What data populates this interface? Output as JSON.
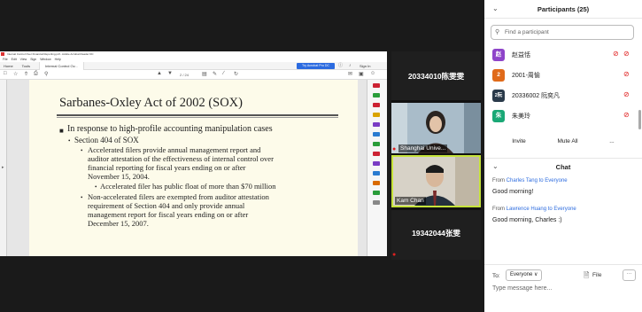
{
  "pdf": {
    "window_title": "Internal Control Over Financial Reporting.pdf - Adobe Acrobat Reader DC",
    "menu": [
      "File",
      "Edit",
      "View",
      "Sign",
      "Window",
      "Help"
    ],
    "tab_home": "Home",
    "tab_tools": "Tools",
    "doc_tab": "Internal Control Ov...",
    "try_pro": "Try Acrobat Pro DC",
    "sign_in": "Sign In",
    "page_indicator": "2 / 24"
  },
  "slide": {
    "title": "Sarbanes-Oxley Act of 2002 (SOX)",
    "l1": "In response to high-profile accounting manipulation cases",
    "l2": "Section 404 of SOX",
    "l3a_1": "Accelerated filers provide annual management report and",
    "l3a_2": "auditor attestation of the effectiveness of internal control over",
    "l3a_3": "financial reporting for fiscal years ending on or after",
    "l3a_4": "November 15, 2004.",
    "l4": "Accelerated filer has public float of more than $70 million",
    "l3b_1": "Non-accelerated filers are exempted from auditor attestation",
    "l3b_2": "requirement of Section 404 and only provide annual",
    "l3b_3": "management report for fiscal years ending on or after",
    "l3b_4": "December 15, 2007."
  },
  "video": {
    "tile1_name": "20334010陈雯雯",
    "tile2_label": "Shanghai Unive...",
    "tile3_label": "Kam Chan",
    "tile4_name": "19342044张雯"
  },
  "participants": {
    "title": "Participants (25)",
    "search_placeholder": "Find a participant",
    "rows": [
      {
        "avatar": "赵",
        "name": "赵益恬",
        "color": "#8e44c9"
      },
      {
        "avatar": "2",
        "name": "2001-周愉",
        "color": "#e06a1a"
      },
      {
        "avatar": "2阮",
        "name": "20336002 阮奕凡",
        "color": "#2a3a4a"
      },
      {
        "avatar": "朱",
        "name": "朱美玲",
        "color": "#1aa876"
      }
    ],
    "invite": "Invite",
    "mute_all": "Mute All",
    "more": "..."
  },
  "chat": {
    "title": "Chat",
    "messages": [
      {
        "from": "From",
        "who": "Charles Tang",
        "to_word": "to",
        "to": "Everyone",
        "text": "Good morning!"
      },
      {
        "from": "From",
        "who": "Lawrence Huang",
        "to_word": "to",
        "to": "Everyone",
        "text": "Good morning, Charles :)"
      }
    ],
    "to_label": "To:",
    "to_value": "Everyone ∨",
    "file": "File",
    "more": "···",
    "placeholder": "Type message here..."
  }
}
